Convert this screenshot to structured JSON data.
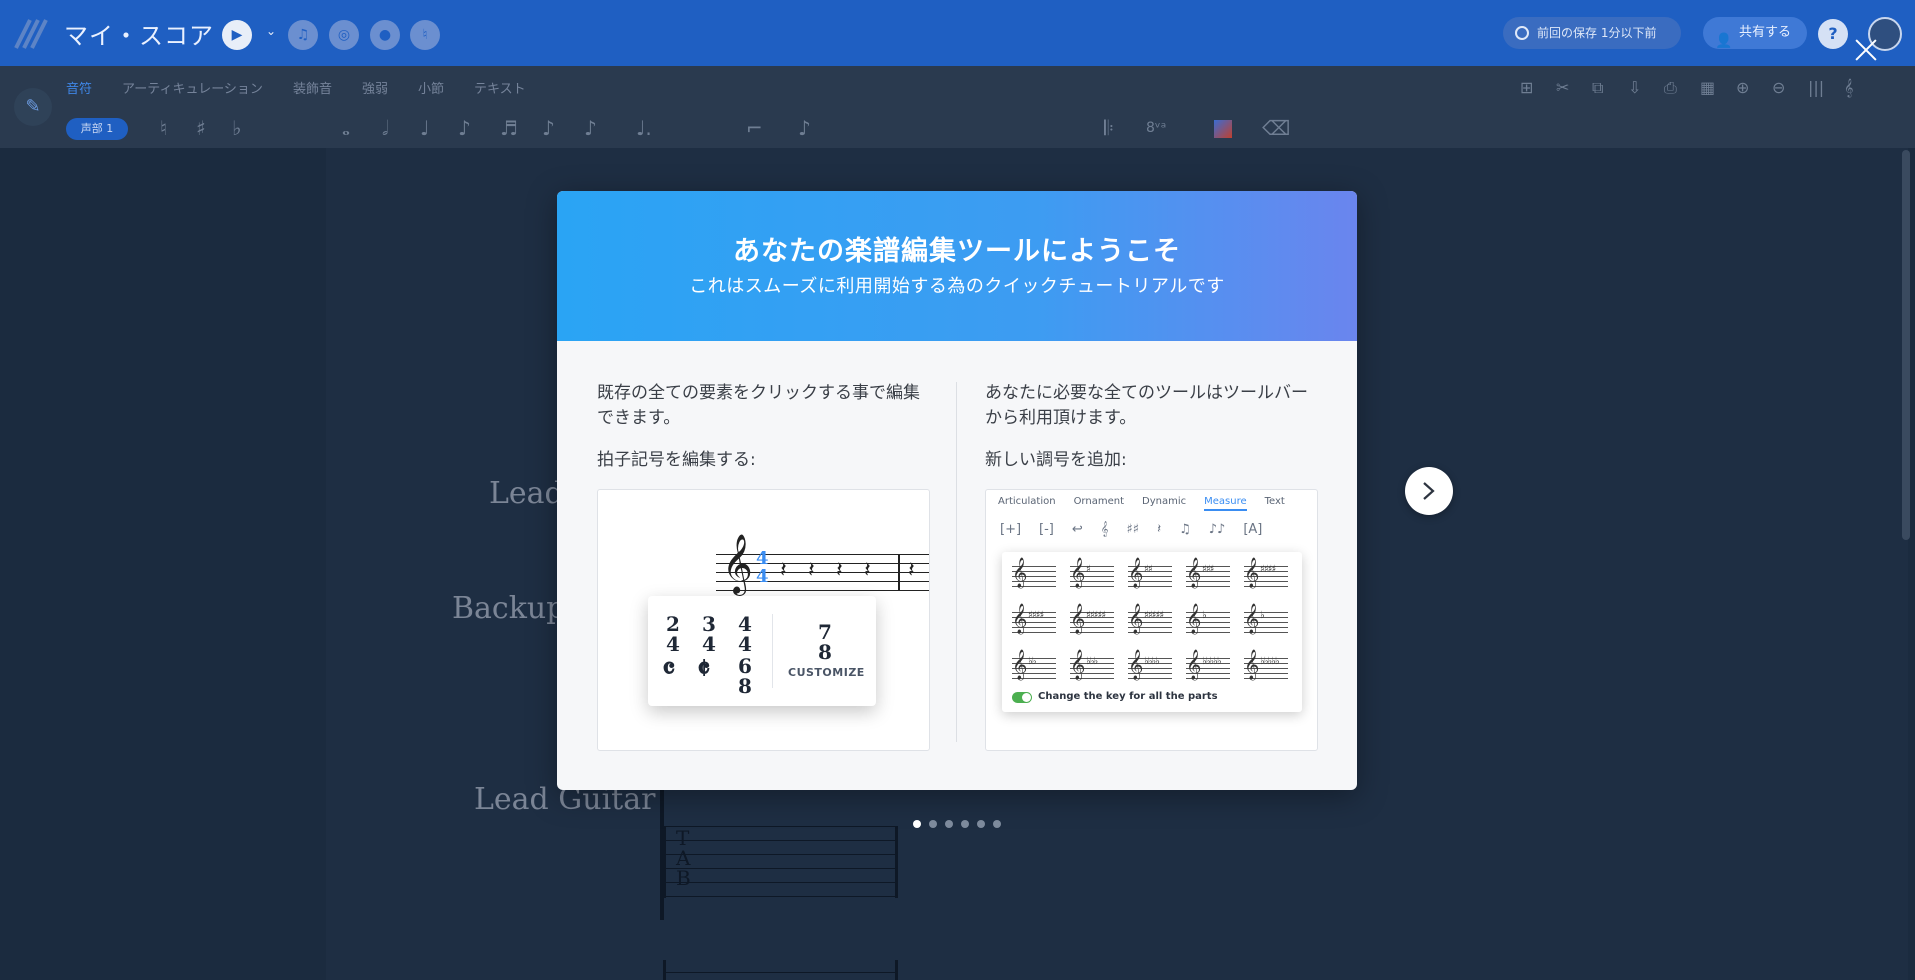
{
  "app": {
    "title": "マイ・スコア",
    "saved_status": "前回の保存 1分以下前",
    "share_label": "共有する",
    "help_label": "?"
  },
  "toolbar": {
    "tabs": [
      {
        "label": "音符",
        "active": true
      },
      {
        "label": "アーティキュレーション",
        "active": false
      },
      {
        "label": "装飾音",
        "active": false
      },
      {
        "label": "強弱",
        "active": false
      },
      {
        "label": "小節",
        "active": false
      },
      {
        "label": "テキスト",
        "active": false
      }
    ],
    "voice_label": "声部 1",
    "ottava_label": "8ᵛᵃ"
  },
  "score": {
    "instruments": [
      "Lead",
      "Backup",
      "Lead Guitar"
    ],
    "tab_letters": "T\nA\nB"
  },
  "modal": {
    "title": "あなたの楽譜編集ツールにようこそ",
    "subtitle": "これはスムーズに利用開始する為のクイックチュートリアルです",
    "left": {
      "text": "既存の全ての要素をクリックする事で編集できます。",
      "label": "拍子記号を編集する:",
      "customize_label": "CUSTOMIZE",
      "custom_num": "7",
      "custom_den": "8",
      "signatures": [
        {
          "num": "2",
          "den": "4"
        },
        {
          "num": "3",
          "den": "4"
        },
        {
          "num": "4",
          "den": "4"
        },
        {
          "num": "6",
          "den": "8"
        }
      ]
    },
    "right": {
      "text": "あなたに必要な全てのツールはツールバーから利用頂けます。",
      "label": "新しい調号を追加:",
      "mini_tabs": [
        {
          "label": "Articulation",
          "active": false
        },
        {
          "label": "Ornament",
          "active": false
        },
        {
          "label": "Dynamic",
          "active": false
        },
        {
          "label": "Measure",
          "active": true
        },
        {
          "label": "Text",
          "active": false
        }
      ],
      "toggle_label": "Change the key for all the parts"
    }
  },
  "pagination": {
    "total": 6,
    "current": 1
  },
  "colors": {
    "brand_blue": "#1f5fc2",
    "header_gradient_start": "#2aa4f4",
    "header_gradient_end": "#6a85ee",
    "accent": "#3a8df2",
    "toggle_green": "#4caf50"
  }
}
